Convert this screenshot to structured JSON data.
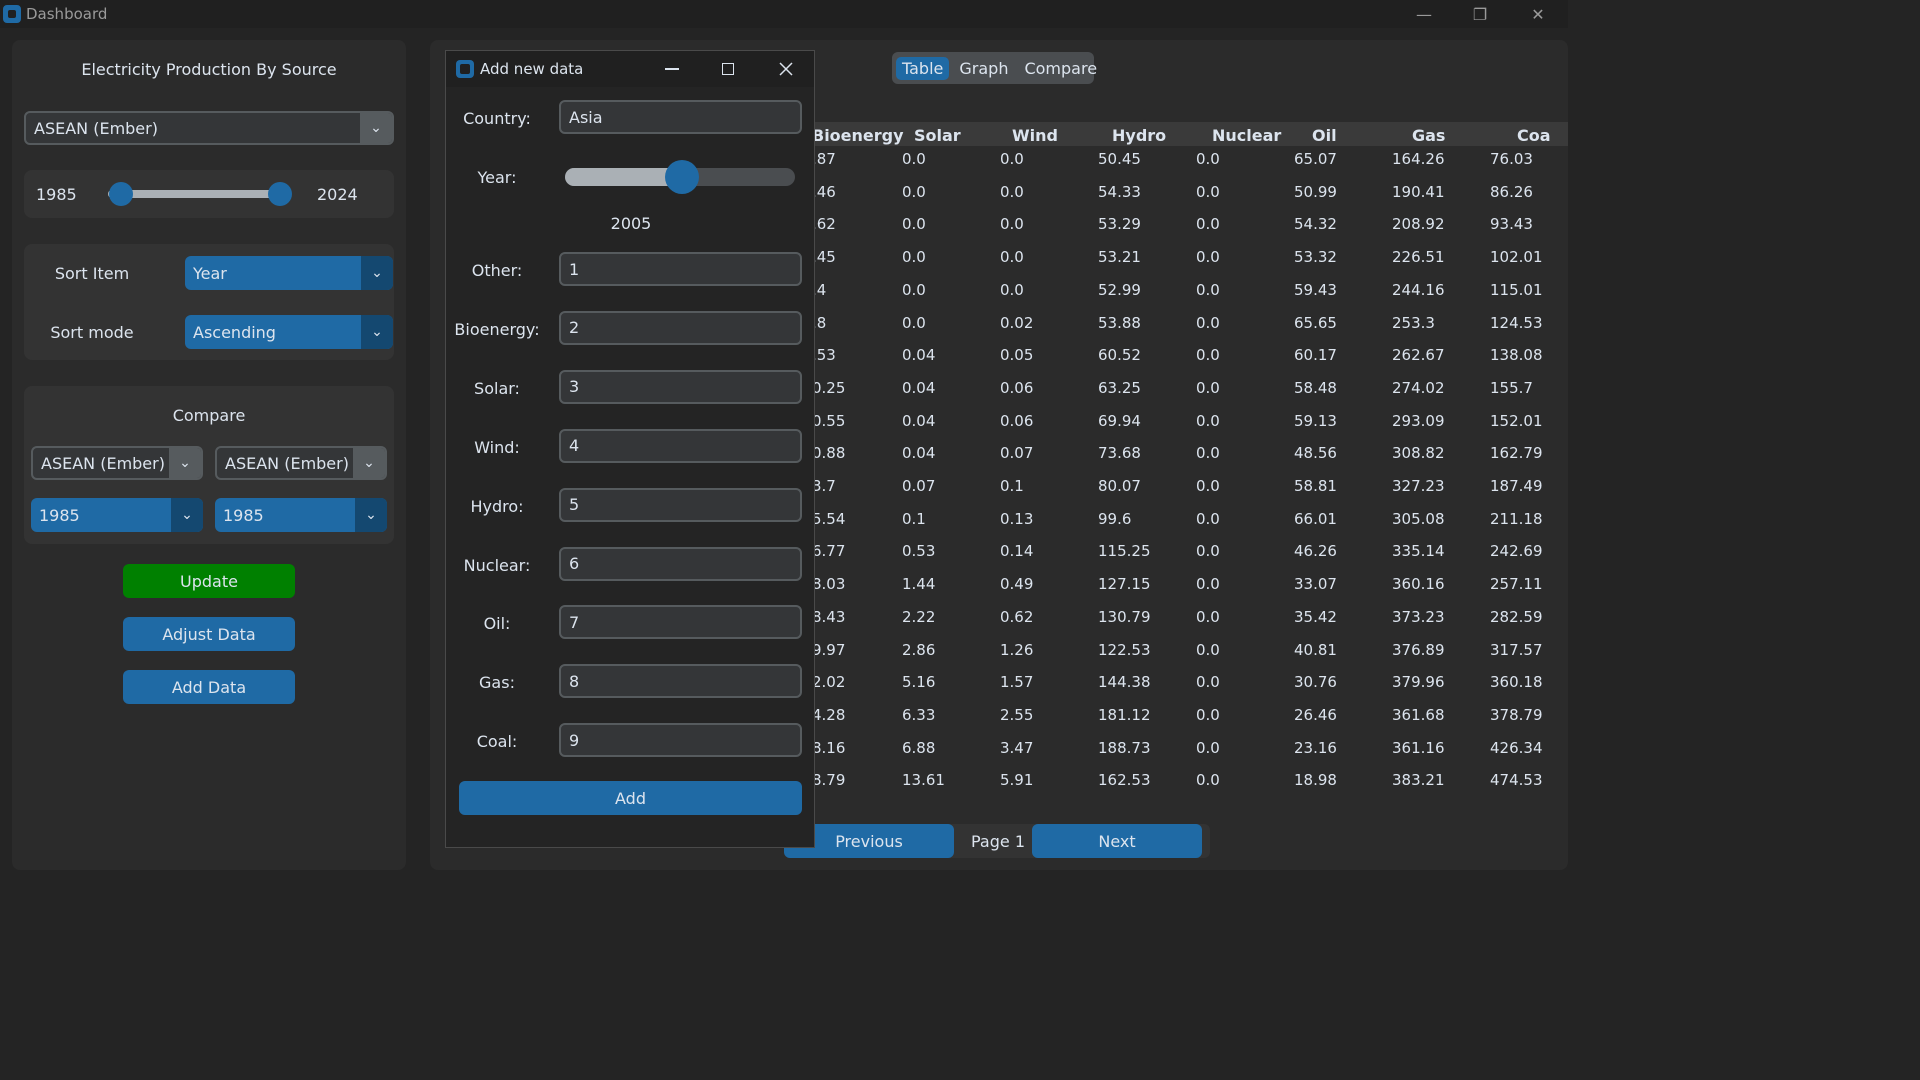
{
  "window": {
    "title": "Dashboard",
    "minimize": "—",
    "restore": "❐",
    "close": "✕"
  },
  "left": {
    "heading": "Electricity Production By Source",
    "region": "ASEAN (Ember)",
    "year_range": {
      "start": "1985",
      "end": "2024",
      "start_fraction": 0.0,
      "end_fraction": 1.0
    },
    "sort_item_label": "Sort Item",
    "sort_item_value": "Year",
    "sort_mode_label": "Sort mode",
    "sort_mode_value": "Ascending",
    "compare_heading": "Compare",
    "compare_region_a": "ASEAN (Ember)",
    "compare_region_b": "ASEAN (Ember)",
    "compare_year_a": "1985",
    "compare_year_b": "1985",
    "update_button": "Update",
    "adjust_button": "Adjust Data",
    "add_button": "Add Data"
  },
  "tabs": [
    {
      "label": "Table",
      "active": true
    },
    {
      "label": "Graph",
      "active": false
    },
    {
      "label": "Compare",
      "active": false
    }
  ],
  "table": {
    "headers": [
      "Bioenergy",
      "Solar",
      "Wind",
      "Hydro",
      "Nuclear",
      "Oil",
      "Gas",
      "Coa"
    ],
    "rows": [
      [
        ".87",
        "0.0",
        "0.0",
        "50.45",
        "0.0",
        "65.07",
        "164.26",
        "76.03"
      ],
      [
        ".46",
        "0.0",
        "0.0",
        "54.33",
        "0.0",
        "50.99",
        "190.41",
        "86.26"
      ],
      [
        ".62",
        "0.0",
        "0.0",
        "53.29",
        "0.0",
        "54.32",
        "208.92",
        "93.43"
      ],
      [
        ".45",
        "0.0",
        "0.0",
        "53.21",
        "0.0",
        "53.32",
        "226.51",
        "102.01"
      ],
      [
        ".4",
        "0.0",
        "0.0",
        "52.99",
        "0.0",
        "59.43",
        "244.16",
        "115.01"
      ],
      [
        ".8",
        "0.0",
        "0.02",
        "53.88",
        "0.0",
        "65.65",
        "253.3",
        "124.53"
      ],
      [
        ".53",
        "0.04",
        "0.05",
        "60.52",
        "0.0",
        "60.17",
        "262.67",
        "138.08"
      ],
      [
        "0.25",
        "0.04",
        "0.06",
        "63.25",
        "0.0",
        "58.48",
        "274.02",
        "155.7"
      ],
      [
        "0.55",
        "0.04",
        "0.06",
        "69.94",
        "0.0",
        "59.13",
        "293.09",
        "152.01"
      ],
      [
        "0.88",
        "0.04",
        "0.07",
        "73.68",
        "0.0",
        "48.56",
        "308.82",
        "162.79"
      ],
      [
        "3.7",
        "0.07",
        "0.1",
        "80.07",
        "0.0",
        "58.81",
        "327.23",
        "187.49"
      ],
      [
        "5.54",
        "0.1",
        "0.13",
        "99.6",
        "0.0",
        "66.01",
        "305.08",
        "211.18"
      ],
      [
        "6.77",
        "0.53",
        "0.14",
        "115.25",
        "0.0",
        "46.26",
        "335.14",
        "242.69"
      ],
      [
        "8.03",
        "1.44",
        "0.49",
        "127.15",
        "0.0",
        "33.07",
        "360.16",
        "257.11"
      ],
      [
        "8.43",
        "2.22",
        "0.62",
        "130.79",
        "0.0",
        "35.42",
        "373.23",
        "282.59"
      ],
      [
        "9.97",
        "2.86",
        "1.26",
        "122.53",
        "0.0",
        "40.81",
        "376.89",
        "317.57"
      ],
      [
        "2.02",
        "5.16",
        "1.57",
        "144.38",
        "0.0",
        "30.76",
        "379.96",
        "360.18"
      ],
      [
        "4.28",
        "6.33",
        "2.55",
        "181.12",
        "0.0",
        "26.46",
        "361.68",
        "378.79"
      ],
      [
        "8.16",
        "6.88",
        "3.47",
        "188.73",
        "0.0",
        "23.16",
        "361.16",
        "426.34"
      ],
      [
        "8.79",
        "13.61",
        "5.91",
        "162.53",
        "0.0",
        "18.98",
        "383.21",
        "474.53"
      ]
    ]
  },
  "pager": {
    "previous": "Previous",
    "page": "Page 1",
    "next": "Next"
  },
  "dialog": {
    "title": "Add new data",
    "country_label": "Country:",
    "country_value": "Asia",
    "year_label": "Year:",
    "year_value": "2005",
    "year_fraction": 0.51,
    "fields": [
      {
        "label": "Other:",
        "value": "1"
      },
      {
        "label": "Bioenergy:",
        "value": "2"
      },
      {
        "label": "Solar:",
        "value": "3"
      },
      {
        "label": "Wind:",
        "value": "4"
      },
      {
        "label": "Hydro:",
        "value": "5"
      },
      {
        "label": "Nuclear:",
        "value": "6"
      },
      {
        "label": "Oil:",
        "value": "7"
      },
      {
        "label": "Gas:",
        "value": "8"
      },
      {
        "label": "Coal:",
        "value": "9"
      }
    ],
    "add_button": "Add"
  }
}
